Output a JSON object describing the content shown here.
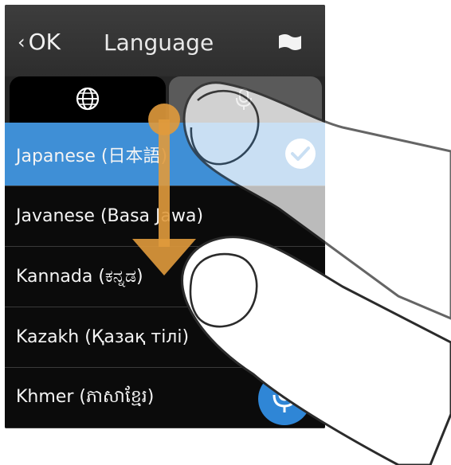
{
  "header": {
    "back_label": "OK",
    "back_icon": "chevron-left-icon",
    "title": "Language",
    "flag_icon": "flag-icon"
  },
  "tabs": [
    {
      "icon": "globe-icon",
      "active": true
    },
    {
      "icon": "microphone-icon",
      "active": false
    }
  ],
  "languages": [
    {
      "label": "Japanese (日本語)",
      "selected": true
    },
    {
      "label": "Javanese (Basa Jawa)",
      "selected": false
    },
    {
      "label": "Kannada (ಕನ್ನಡ)",
      "selected": false
    },
    {
      "label": "Kazakh (Қазақ тілі)",
      "selected": false
    },
    {
      "label": "Khmer (ភាសាខ្មែរ)",
      "selected": false
    }
  ],
  "colors": {
    "selected_row": "#3f8fd6",
    "header_bg": "#333333",
    "accent": "#2f86d6",
    "gesture_arrow": "#e09a3c"
  },
  "gesture": {
    "type": "swipe-down",
    "icons": [
      "finger-start-icon",
      "finger-end-icon",
      "swipe-arrow-icon"
    ]
  }
}
